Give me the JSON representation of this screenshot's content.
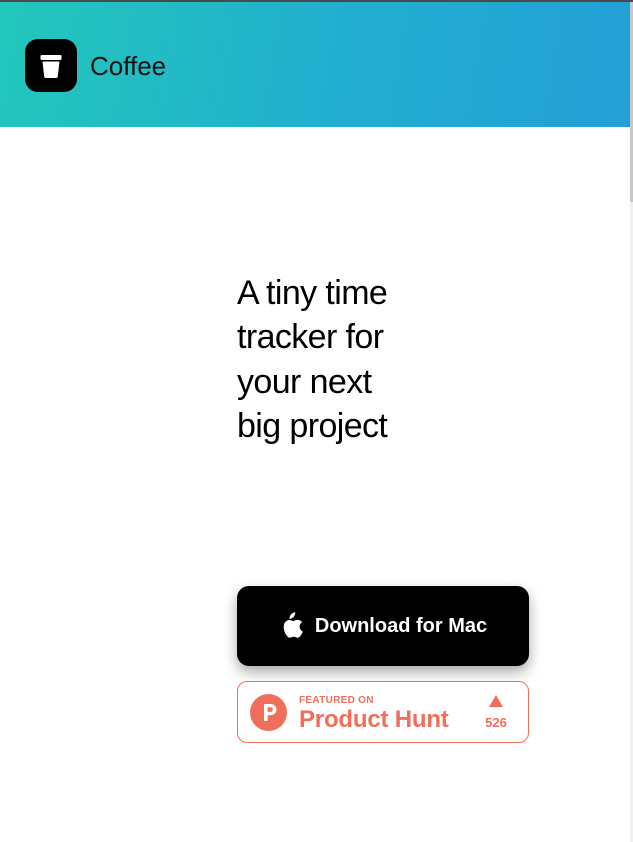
{
  "brand": {
    "name": "Coffee",
    "logo_icon": "coffee-cup-icon"
  },
  "hero": {
    "headline": "A tiny time tracker for your next big project"
  },
  "download_button": {
    "label": "Download for Mac",
    "icon": "apple-icon"
  },
  "product_hunt": {
    "featured_label": "FEATURED ON",
    "name": "Product Hunt",
    "upvotes": "526",
    "icon": "product-hunt-icon",
    "upvote_icon": "upvote-arrow-icon"
  },
  "colors": {
    "header_gradient_start": "#22c7bb",
    "header_gradient_end": "#239fd6",
    "product_hunt_accent": "#f06e5a",
    "button_background": "#000000"
  }
}
